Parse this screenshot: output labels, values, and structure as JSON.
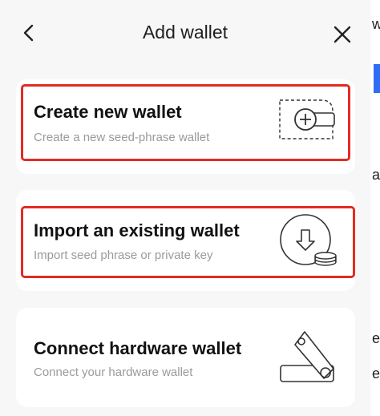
{
  "header": {
    "title": "Add wallet",
    "back_icon": "chevron-left-icon",
    "close_icon": "close-icon"
  },
  "options": [
    {
      "title": "Create new wallet",
      "subtitle": "Create a new seed-phrase wallet",
      "icon": "wallet-plus-icon",
      "highlighted": true
    },
    {
      "title": "Import an existing wallet",
      "subtitle": "Import seed phrase or private key",
      "icon": "import-download-icon",
      "highlighted": true
    },
    {
      "title": "Connect hardware wallet",
      "subtitle": "Connect your hardware wallet",
      "icon": "usb-hardware-wallet-icon",
      "highlighted": false
    }
  ],
  "colors": {
    "highlight": "#e32b22",
    "background": "#f7f7f8",
    "card": "#ffffff",
    "subtitle": "#9a9a9a"
  },
  "backdrop": {
    "chars": [
      "w",
      "a",
      "e",
      "e"
    ]
  }
}
